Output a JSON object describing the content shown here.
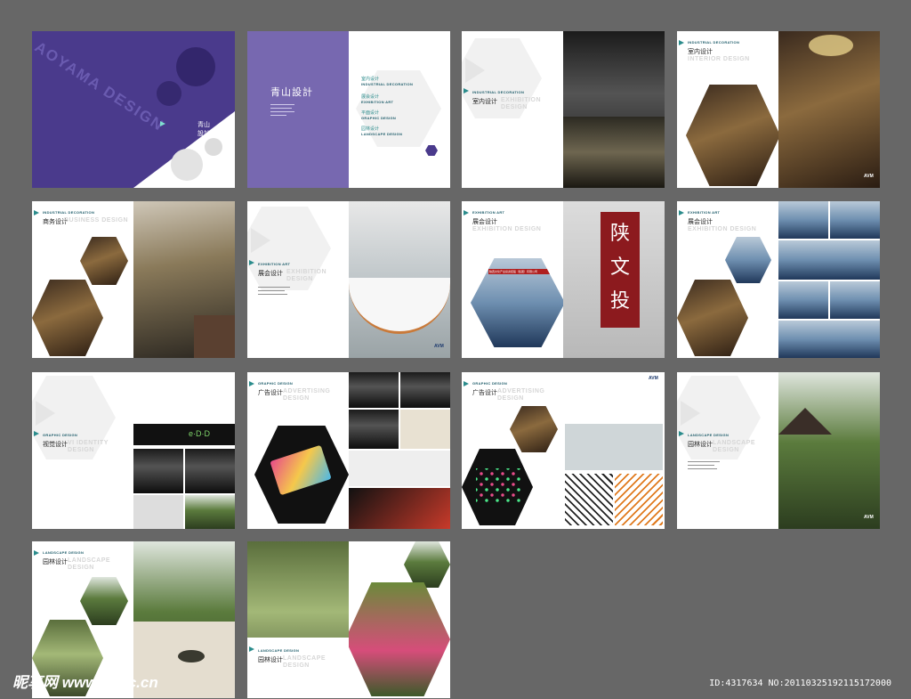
{
  "brand": {
    "vertical_title": "AOYAMA DESIGN",
    "cn_title": "青山設計",
    "avm": "AVM"
  },
  "toc": [
    {
      "cn": "室内设计",
      "en": "INDUSTRIAL DECORATION"
    },
    {
      "cn": "展会设计",
      "en": "EXHIBITION ART"
    },
    {
      "cn": "平面设计",
      "en": "GRAPHIC DESIGN"
    },
    {
      "cn": "园林设计",
      "en": "LANDSCAPE DESIGN"
    }
  ],
  "sections": {
    "interior": {
      "en": "INDUSTRIAL DECORATION",
      "cn": "室内设计",
      "ghost": "EXHIBITION DESIGN"
    },
    "interior2": {
      "en": "INDUSTRIAL DECORATION",
      "cn": "室内设计",
      "ghost": "INTERIOR DESIGN"
    },
    "business": {
      "en": "INDUSTRIAL DECORATION",
      "cn": "商务设计",
      "ghost": "BUSINESS DESIGN"
    },
    "exhibit1": {
      "en": "EXHIBITION ART",
      "cn": "展会设计",
      "ghost": "EXHIBITION DESIGN"
    },
    "exhibit2": {
      "en": "EXHIBITION ART",
      "cn": "展会设计",
      "ghost": "EXHIBITION DESIGN"
    },
    "exhibit3": {
      "en": "EXHIBITION ART",
      "cn": "展会设计",
      "ghost": "EXHIBITION DESIGN"
    },
    "vi": {
      "en": "GRAPHIC DESIGN",
      "cn": "视觉设计",
      "ghost": "VI IDENTITY DESIGN"
    },
    "adv1": {
      "en": "GRAPHIC DESIGN",
      "cn": "广告设计",
      "ghost": "ADVERTISING DESIGN"
    },
    "adv2": {
      "en": "GRAPHIC DESIGN",
      "cn": "广告设计",
      "ghost": "ADVERTISING DESIGN"
    },
    "land1": {
      "en": "LANDSCAPE DESIGN",
      "cn": "园林设计",
      "ghost": "LANDSCAPE DESIGN"
    },
    "land2": {
      "en": "LANDSCAPE DESIGN",
      "cn": "园林设计",
      "ghost": "LANDSCAPE DESIGN"
    },
    "land3": {
      "en": "LANDSCAPE DESIGN",
      "cn": "园林设计",
      "ghost": "LANDSCAPE DESIGN"
    }
  },
  "booth_sign": "陕西文化产业投资控股（集团）有限公司",
  "calligraphy": "陕文投",
  "vi_logo": "e·D·D",
  "watermark": {
    "left": "昵享网 www.nipic.cn",
    "right": "ID:4317634 NO:20110325192115172000"
  },
  "colors": {
    "purple": "#4a3a8c",
    "teal": "#2b8c8c",
    "bg": "#676767"
  }
}
